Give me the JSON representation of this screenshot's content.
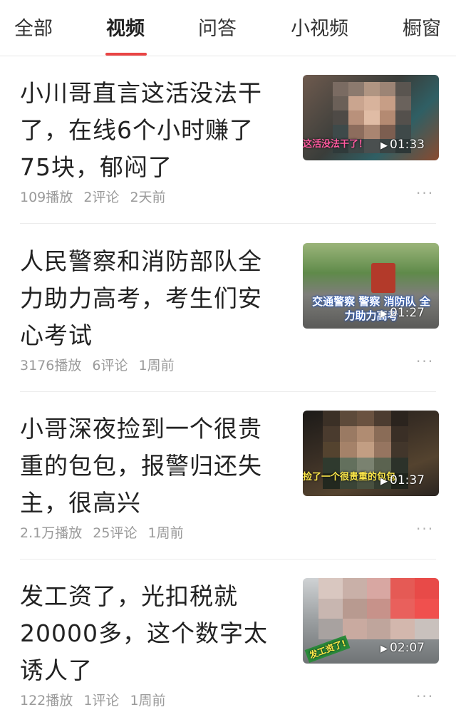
{
  "tabs": [
    {
      "label": "全部"
    },
    {
      "label": "视频"
    },
    {
      "label": "问答"
    },
    {
      "label": "小视频"
    },
    {
      "label": "橱窗"
    }
  ],
  "active_tab": "视频",
  "colors": {
    "accent": "#e94444",
    "meta": "#9a9a9a"
  },
  "items": [
    {
      "title": "小川哥直言这活没法干了，在线6个小时赚了75块，郁闷了",
      "plays": "109播放",
      "comments": "2评论",
      "time": "2天前",
      "duration": "01:33",
      "caption": "这活没法干了！"
    },
    {
      "title": "人民警察和消防部队全力助力高考，考生们安心考试",
      "plays": "3176播放",
      "comments": "6评论",
      "time": "1周前",
      "duration": "01:27",
      "caption": "交通警察 警察 消防队 全力助力高考"
    },
    {
      "title": "小哥深夜捡到一个很贵重的包包，报警归还失主，很高兴",
      "plays": "2.1万播放",
      "comments": "25评论",
      "time": "1周前",
      "duration": "01:37",
      "caption": "捡了一个很贵重的包包"
    },
    {
      "title": "发工资了，光扣税就20000多，这个数字太诱人了",
      "plays": "122播放",
      "comments": "1评论",
      "time": "1周前",
      "duration": "02:07",
      "caption": "发工资了!"
    }
  ],
  "more_icon": "ellipsis-icon",
  "play_icon": "play-icon"
}
